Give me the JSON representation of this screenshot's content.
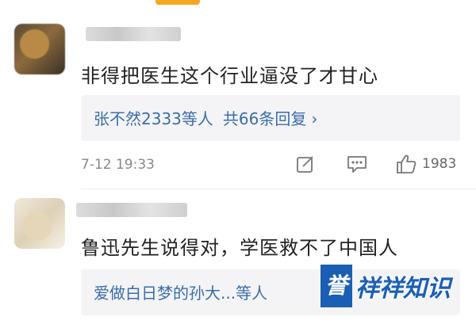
{
  "comments": [
    {
      "text": "非得把医生这个行业逼没了才甘心",
      "reply": {
        "names": "张不然2333等人",
        "count_label": "共66条回复"
      },
      "time": "7-12 19:33",
      "likes": "1983"
    },
    {
      "text": "鲁迅先生说得对，学医救不了中国人",
      "reply": {
        "names": "爱做白日梦的孙大...等人"
      }
    }
  ],
  "icons": {
    "reply": "edit-icon",
    "comment": "comment-icon",
    "like": "thumbs-up-icon",
    "chevron": "chevron-right-icon"
  },
  "watermark": {
    "badge": "誉",
    "text": "祥祥知识"
  },
  "colors": {
    "accent": "#f6a623",
    "link": "#3a6ea8",
    "brand": "#1a5fb4"
  }
}
